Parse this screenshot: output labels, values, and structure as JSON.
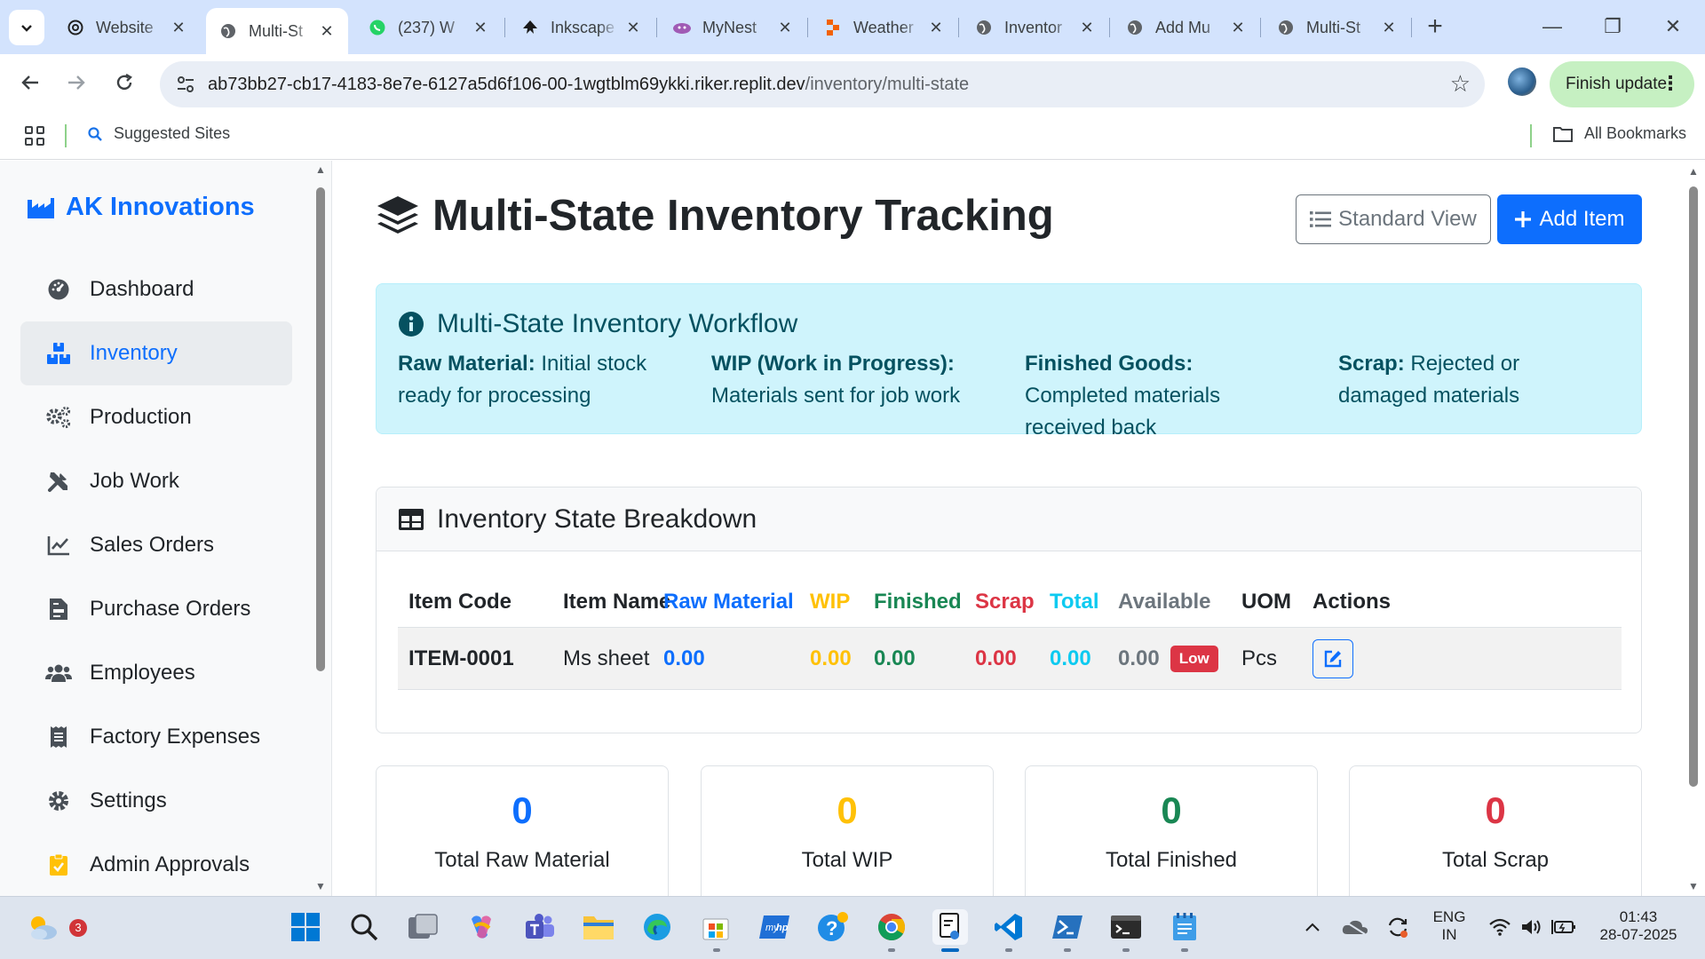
{
  "browser": {
    "tabs": [
      {
        "title": "Website",
        "icon": "openai-icon"
      },
      {
        "title": "Multi-St",
        "icon": "globe-icon",
        "active": true
      },
      {
        "title": "(237) W",
        "icon": "whatsapp-icon"
      },
      {
        "title": "Inkscape",
        "icon": "inkscape-icon"
      },
      {
        "title": "MyNest",
        "icon": "mynest-icon"
      },
      {
        "title": "Weather",
        "icon": "replit-icon"
      },
      {
        "title": "Inventor",
        "icon": "globe-icon"
      },
      {
        "title": "Add Mu",
        "icon": "globe-icon"
      },
      {
        "title": "Multi-St",
        "icon": "globe-icon"
      }
    ],
    "url_host": "ab73bb27-cb17-4183-8e7e-6127a5d6f106-00-1wgtblm69ykki.riker.replit.dev",
    "url_path": "/inventory/multi-state",
    "finish_update": "Finish update",
    "bookmarks": {
      "suggested": "Suggested Sites",
      "all": "All Bookmarks"
    }
  },
  "sidebar": {
    "brand": "AK Innovations",
    "items": [
      {
        "label": "Dashboard",
        "icon": "gauge-icon"
      },
      {
        "label": "Inventory",
        "icon": "boxes-icon",
        "active": true
      },
      {
        "label": "Production",
        "icon": "cogs-icon"
      },
      {
        "label": "Job Work",
        "icon": "tools-icon"
      },
      {
        "label": "Sales Orders",
        "icon": "chart-line-icon"
      },
      {
        "label": "Purchase Orders",
        "icon": "file-invoice-icon"
      },
      {
        "label": "Employees",
        "icon": "users-icon"
      },
      {
        "label": "Factory Expenses",
        "icon": "receipt-icon"
      },
      {
        "label": "Settings",
        "icon": "gear-icon"
      },
      {
        "label": "Admin Approvals",
        "icon": "clipboard-check-icon"
      }
    ]
  },
  "main": {
    "title": "Multi-State Inventory Tracking",
    "standard_view": "Standard View",
    "add_item": "Add Item",
    "workflow": {
      "title": "Multi-State Inventory Workflow",
      "states": [
        {
          "name": "Raw Material:",
          "desc": "Initial stock ready for processing"
        },
        {
          "name": "WIP (Work in Progress):",
          "desc": "Materials sent for job work"
        },
        {
          "name": "Finished Goods:",
          "desc": "Completed materials received back"
        },
        {
          "name": "Scrap:",
          "desc": "Rejected or damaged materials"
        }
      ]
    },
    "breakdown": {
      "title": "Inventory State Breakdown",
      "columns": [
        "Item Code",
        "Item Name",
        "Raw Material",
        "WIP",
        "Finished",
        "Scrap",
        "Total",
        "Available",
        "UOM",
        "Actions"
      ],
      "rows": [
        {
          "code": "ITEM-0001",
          "name": "Ms sheet",
          "raw": "0.00",
          "wip": "0.00",
          "finished": "0.00",
          "scrap": "0.00",
          "total": "0.00",
          "available": "0.00",
          "badge": "Low",
          "uom": "Pcs"
        }
      ]
    },
    "stats": [
      {
        "value": "0",
        "label": "Total Raw Material",
        "color": "#0d6efd"
      },
      {
        "value": "0",
        "label": "Total WIP",
        "color": "#ffc107"
      },
      {
        "value": "0",
        "label": "Total Finished",
        "color": "#198754"
      },
      {
        "value": "0",
        "label": "Total Scrap",
        "color": "#dc3545"
      }
    ]
  },
  "colors": {
    "primary": "#0d6efd",
    "warning": "#ffc107",
    "success": "#198754",
    "danger": "#dc3545",
    "info": "#0dcaf0",
    "muted": "#6c757d"
  },
  "taskbar": {
    "weather_badge": "3",
    "lang": "ENG",
    "region": "IN",
    "time": "01:43",
    "date": "28-07-2025"
  }
}
